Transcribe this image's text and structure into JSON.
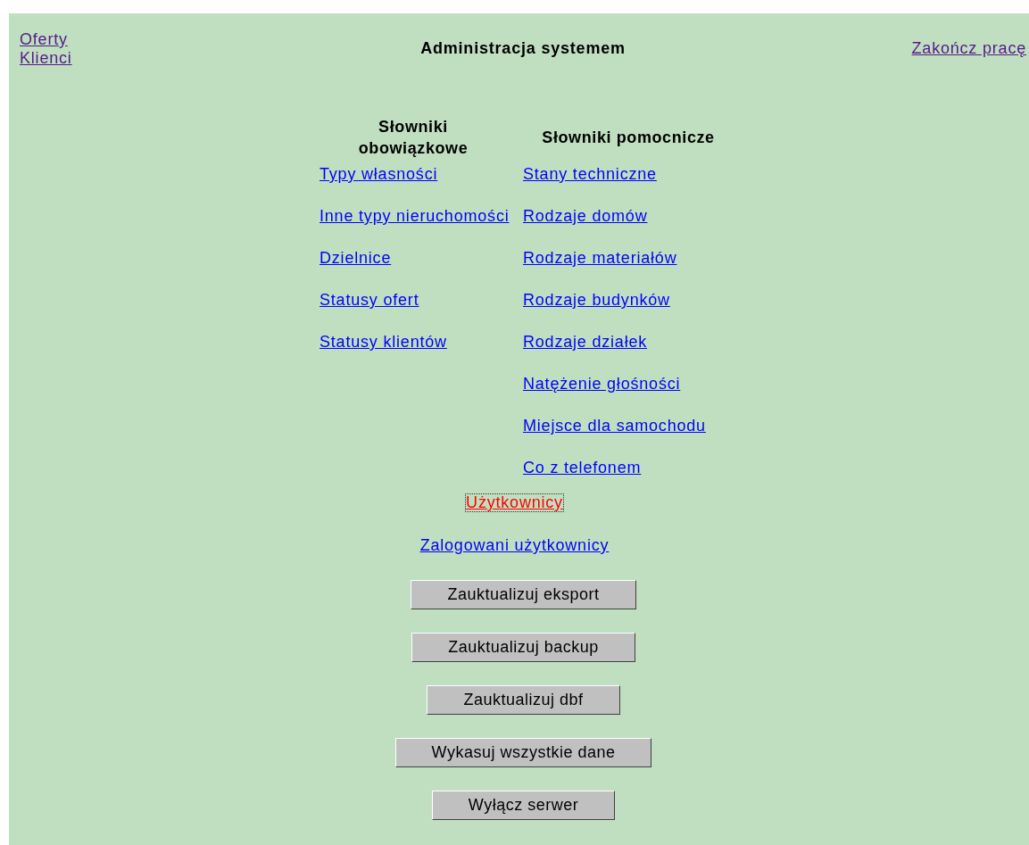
{
  "nav": [
    {
      "label": "Oferty",
      "visited": true,
      "active": false
    },
    {
      "label": "Klienci",
      "visited": true,
      "active": false
    }
  ],
  "title": "Administracja systemem",
  "logout": {
    "label": "Zakończ pracę",
    "visited": true,
    "active": false
  },
  "columns": [
    {
      "heading": "Słowniki obowiązkowe",
      "links": [
        {
          "label": "Typy własności",
          "visited": false,
          "active": false
        },
        {
          "label": "Inne typy nieruchomości",
          "visited": false,
          "active": false
        },
        {
          "label": "Dzielnice",
          "visited": false,
          "active": false
        },
        {
          "label": "Statusy ofert",
          "visited": false,
          "active": false
        },
        {
          "label": "Statusy klientów",
          "visited": false,
          "active": false
        }
      ]
    },
    {
      "heading": "Słowniki pomocnicze",
      "links": [
        {
          "label": "Stany techniczne",
          "visited": false,
          "active": false
        },
        {
          "label": "Rodzaje domów",
          "visited": false,
          "active": false
        },
        {
          "label": "Rodzaje materiałów",
          "visited": false,
          "active": false
        },
        {
          "label": "Rodzaje budynków",
          "visited": false,
          "active": false
        },
        {
          "label": "Rodzaje działek",
          "visited": false,
          "active": false
        },
        {
          "label": "Natężenie głośności",
          "visited": false,
          "active": false
        },
        {
          "label": "Miejsce dla samochodu",
          "visited": false,
          "active": false
        },
        {
          "label": "Co z telefonem",
          "visited": false,
          "active": false
        }
      ]
    }
  ],
  "user_links": [
    {
      "label": "Użytkownicy",
      "visited": false,
      "active": true
    },
    {
      "label": "Zalogowani użytkownicy",
      "visited": false,
      "active": false
    }
  ],
  "buttons": [
    "Zauktualizuj eksport",
    "Zauktualizuj backup",
    "Zauktualizuj dbf",
    "Wykasuj wszystkie dane",
    "Wyłącz serwer"
  ]
}
